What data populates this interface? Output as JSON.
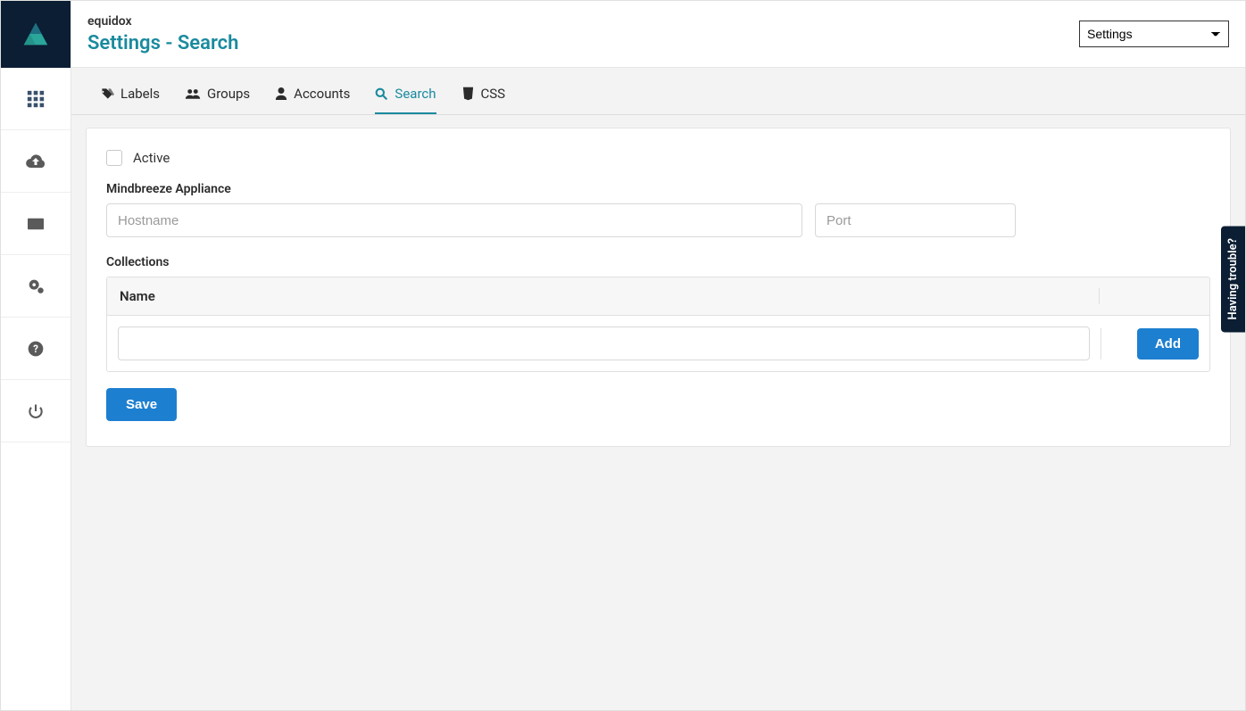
{
  "header": {
    "app_name": "equidox",
    "page_title": "Settings - Search",
    "dropdown_selected": "Settings"
  },
  "tabs": [
    {
      "label": "Labels"
    },
    {
      "label": "Groups"
    },
    {
      "label": "Accounts"
    },
    {
      "label": "Search"
    },
    {
      "label": "CSS"
    }
  ],
  "form": {
    "active_label": "Active",
    "appliance_label": "Mindbreeze Appliance",
    "hostname_placeholder": "Hostname",
    "port_placeholder": "Port",
    "collections_label": "Collections",
    "table_header_name": "Name",
    "add_button": "Add",
    "save_button": "Save"
  },
  "trouble_tab": "Having trouble?"
}
